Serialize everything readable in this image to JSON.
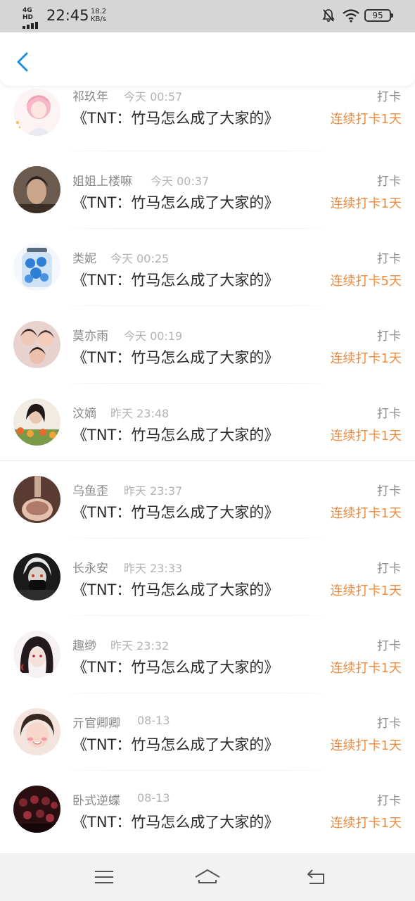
{
  "status_bar": {
    "network": "4G HD",
    "time": "22:45",
    "speed_value": "18.2",
    "speed_unit": "KB/s",
    "battery": "95"
  },
  "header": {
    "back_icon": "chevron-left-icon"
  },
  "accent_color": "#1e8fe1",
  "streak_color": "#f08a3c",
  "items": [
    {
      "username": "祁玖年",
      "time": "今天 00:57",
      "title": "《TNT：竹马怎么成了大家的》",
      "action": "打卡",
      "streak": "连续打卡1天"
    },
    {
      "username": "姐姐上楼嘛",
      "time": "今天 00:37",
      "title": "《TNT：竹马怎么成了大家的》",
      "action": "打卡",
      "streak": "连续打卡1天"
    },
    {
      "username": "类妮",
      "time": "今天 00:25",
      "title": "《TNT：竹马怎么成了大家的》",
      "action": "打卡",
      "streak": "连续打卡5天"
    },
    {
      "username": "莫亦雨",
      "time": "今天 00:19",
      "title": "《TNT：竹马怎么成了大家的》",
      "action": "打卡",
      "streak": "连续打卡1天"
    },
    {
      "username": "汶嫡",
      "time": "昨天 23:48",
      "title": "《TNT：竹马怎么成了大家的》",
      "action": "打卡",
      "streak": "连续打卡1天"
    },
    {
      "username": "乌鱼歪",
      "time": "昨天 23:37",
      "title": "《TNT：竹马怎么成了大家的》",
      "action": "打卡",
      "streak": "连续打卡1天"
    },
    {
      "username": "长永安",
      "time": "昨天 23:33",
      "title": "《TNT：竹马怎么成了大家的》",
      "action": "打卡",
      "streak": "连续打卡1天"
    },
    {
      "username": "趣缈",
      "time": "昨天 23:32",
      "title": "《TNT：竹马怎么成了大家的》",
      "action": "打卡",
      "streak": "连续打卡1天"
    },
    {
      "username": "亓官卿卿",
      "time": "08-13",
      "title": "《TNT：竹马怎么成了大家的》",
      "action": "打卡",
      "streak": "连续打卡1天"
    },
    {
      "username": "卧式逆蝶",
      "time": "08-13",
      "title": "《TNT：竹马怎么成了大家的》",
      "action": "打卡",
      "streak": "连续打卡1天"
    }
  ],
  "nav_bar": {
    "menu_icon": "menu-icon",
    "home_icon": "home-icon",
    "back_icon": "back-arrow-icon"
  }
}
